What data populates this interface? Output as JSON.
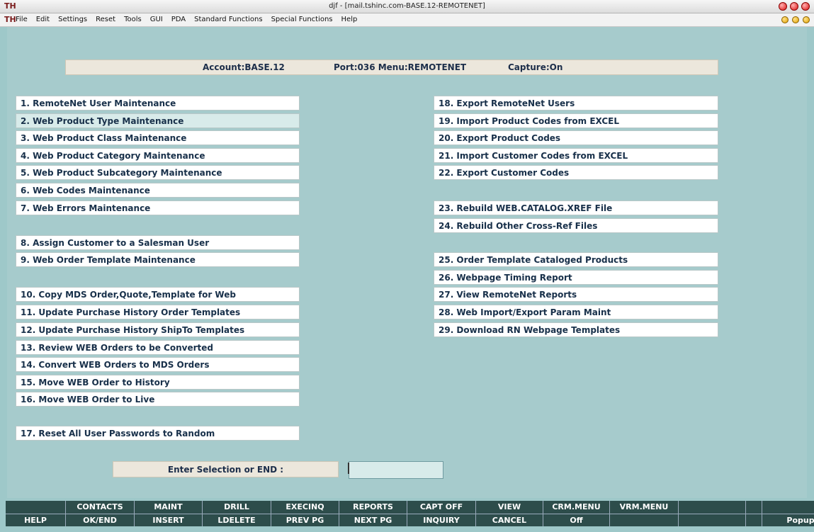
{
  "window": {
    "title": "djf - [mail.tshinc.com-BASE.12-REMOTENET]",
    "app_icon": "TH"
  },
  "menubar": {
    "items": [
      "File",
      "Edit",
      "Settings",
      "Reset",
      "Tools",
      "GUI",
      "PDA",
      "Standard Functions",
      "Special Functions",
      "Help"
    ]
  },
  "header": {
    "account": "Account:BASE.12",
    "port_menu": "Port:036 Menu:REMOTENET",
    "capture": "Capture:On"
  },
  "menu_left": [
    "1. RemoteNet User Maintenance",
    "2. Web Product Type Maintenance",
    "3. Web Product Class Maintenance",
    "4. Web Product Category Maintenance",
    "5. Web Product Subcategory Maintenance",
    "6. Web Codes Maintenance",
    "7. Web Errors Maintenance",
    "8. Assign Customer to a Salesman User",
    "9. Web Order Template Maintenance",
    "10. Copy MDS Order,Quote,Template for Web",
    "11. Update Purchase History Order Templates",
    "12. Update Purchase History ShipTo Templates",
    "13. Review WEB Orders to be Converted",
    "14. Convert WEB Orders to MDS Orders",
    "15. Move WEB Order to History",
    "16. Move WEB Order to Live",
    "17. Reset All User Passwords to Random"
  ],
  "menu_right": [
    "18. Export RemoteNet Users",
    "19. Import Product Codes from EXCEL",
    "20. Export Product Codes",
    "21. Import Customer Codes from EXCEL",
    "22. Export Customer Codes",
    "23. Rebuild WEB.CATALOG.XREF File",
    "24. Rebuild Other Cross-Ref Files",
    "25. Order Template Cataloged Products",
    "26. Webpage Timing Report",
    "27. View RemoteNet Reports",
    "28. Web Import/Export Param Maint",
    "29. Download RN Webpage Templates"
  ],
  "prompt": {
    "label": "Enter Selection or END :",
    "value": ""
  },
  "fkeys_top": [
    "",
    "CONTACTS",
    "MAINT",
    "DRILL",
    "EXECINQ",
    "REPORTS",
    "CAPT OFF",
    "VIEW",
    "CRM.MENU",
    "VRM.MENU",
    "",
    "",
    ""
  ],
  "fkeys_bottom": [
    "HELP",
    "OK/END",
    "INSERT",
    "LDELETE",
    "PREV PG",
    "NEXT PG",
    "INQUIRY",
    "CANCEL",
    "Off",
    "",
    "",
    "",
    "Popup"
  ],
  "colors": {
    "background": "#a6cbcc",
    "fkey_bg": "#2d4d4b",
    "text": "#18304a",
    "selected_item": "#d8ebea"
  }
}
